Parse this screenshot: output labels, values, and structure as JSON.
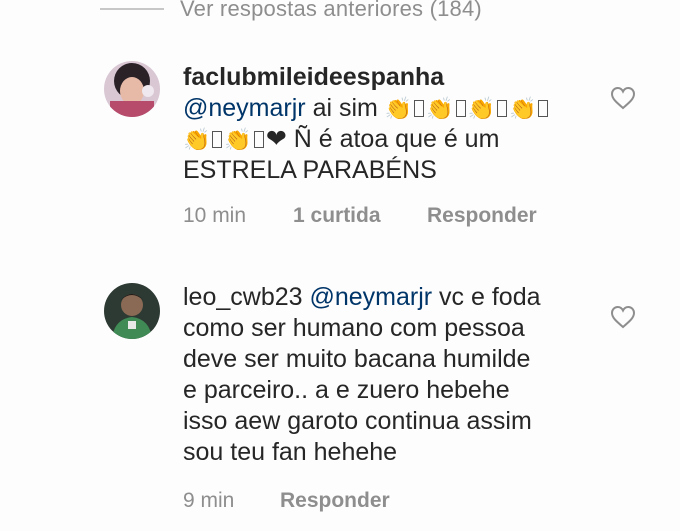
{
  "view_previous": "Ver respostas anteriores (184)",
  "comments": [
    {
      "username": "faclubmileideespanha",
      "mention": "@neymarjr",
      "line1_text": " ai sim ",
      "line2_tail": "Ñ é atoa que é um",
      "line3": "ESTRELA PARABÉNS",
      "time": "10 min",
      "likes": "1 curtida",
      "reply": "Responder"
    },
    {
      "username": "leo_cwb23",
      "mention": "@neymarjr",
      "line1_tail": " vc  e foda",
      "lines": [
        "como ser humano com pessoa",
        "deve ser muito bacana  humilde",
        "e parceiro.. a e zuero hebehe",
        "isso aew garoto  continua  assim",
        "sou teu fan hehehe"
      ],
      "time": "9 min",
      "reply": "Responder"
    }
  ],
  "icons": {
    "clap": "clapping-hands-icon",
    "heart": "heart-outline-icon",
    "missing_glyph": "missing-glyph-box"
  },
  "colors": {
    "mention": "#003569",
    "meta": "#8e8e8e",
    "clap": "#c9a0e6"
  }
}
